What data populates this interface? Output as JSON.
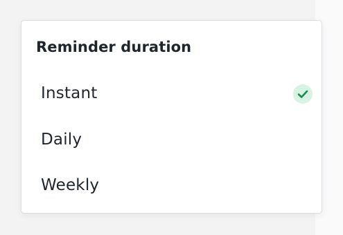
{
  "menu": {
    "title": "Reminder duration",
    "options": [
      {
        "label": "Instant",
        "selected": true
      },
      {
        "label": "Daily",
        "selected": false
      },
      {
        "label": "Weekly",
        "selected": false
      }
    ]
  },
  "icons": {
    "selected": "check-icon"
  },
  "colors": {
    "check_bg": "#d6f3e3",
    "check_mark": "#1f8a4c",
    "text": "#1f252c",
    "page_bg": "#f3f3f4"
  }
}
